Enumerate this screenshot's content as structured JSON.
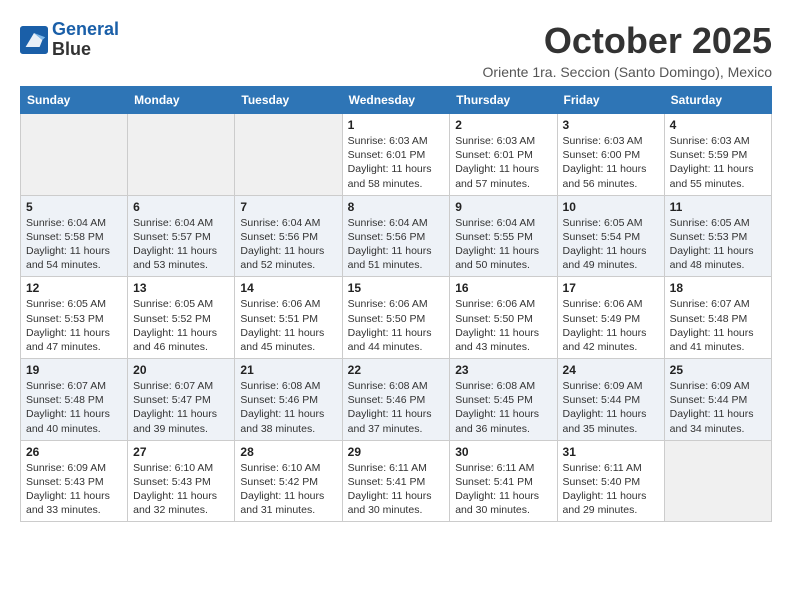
{
  "header": {
    "logo_line1": "General",
    "logo_line2": "Blue",
    "month_title": "October 2025",
    "subtitle": "Oriente 1ra. Seccion (Santo Domingo), Mexico"
  },
  "weekdays": [
    "Sunday",
    "Monday",
    "Tuesday",
    "Wednesday",
    "Thursday",
    "Friday",
    "Saturday"
  ],
  "weeks": [
    [
      {
        "day": "",
        "info": ""
      },
      {
        "day": "",
        "info": ""
      },
      {
        "day": "",
        "info": ""
      },
      {
        "day": "1",
        "info": "Sunrise: 6:03 AM\nSunset: 6:01 PM\nDaylight: 11 hours and 58 minutes."
      },
      {
        "day": "2",
        "info": "Sunrise: 6:03 AM\nSunset: 6:01 PM\nDaylight: 11 hours and 57 minutes."
      },
      {
        "day": "3",
        "info": "Sunrise: 6:03 AM\nSunset: 6:00 PM\nDaylight: 11 hours and 56 minutes."
      },
      {
        "day": "4",
        "info": "Sunrise: 6:03 AM\nSunset: 5:59 PM\nDaylight: 11 hours and 55 minutes."
      }
    ],
    [
      {
        "day": "5",
        "info": "Sunrise: 6:04 AM\nSunset: 5:58 PM\nDaylight: 11 hours and 54 minutes."
      },
      {
        "day": "6",
        "info": "Sunrise: 6:04 AM\nSunset: 5:57 PM\nDaylight: 11 hours and 53 minutes."
      },
      {
        "day": "7",
        "info": "Sunrise: 6:04 AM\nSunset: 5:56 PM\nDaylight: 11 hours and 52 minutes."
      },
      {
        "day": "8",
        "info": "Sunrise: 6:04 AM\nSunset: 5:56 PM\nDaylight: 11 hours and 51 minutes."
      },
      {
        "day": "9",
        "info": "Sunrise: 6:04 AM\nSunset: 5:55 PM\nDaylight: 11 hours and 50 minutes."
      },
      {
        "day": "10",
        "info": "Sunrise: 6:05 AM\nSunset: 5:54 PM\nDaylight: 11 hours and 49 minutes."
      },
      {
        "day": "11",
        "info": "Sunrise: 6:05 AM\nSunset: 5:53 PM\nDaylight: 11 hours and 48 minutes."
      }
    ],
    [
      {
        "day": "12",
        "info": "Sunrise: 6:05 AM\nSunset: 5:53 PM\nDaylight: 11 hours and 47 minutes."
      },
      {
        "day": "13",
        "info": "Sunrise: 6:05 AM\nSunset: 5:52 PM\nDaylight: 11 hours and 46 minutes."
      },
      {
        "day": "14",
        "info": "Sunrise: 6:06 AM\nSunset: 5:51 PM\nDaylight: 11 hours and 45 minutes."
      },
      {
        "day": "15",
        "info": "Sunrise: 6:06 AM\nSunset: 5:50 PM\nDaylight: 11 hours and 44 minutes."
      },
      {
        "day": "16",
        "info": "Sunrise: 6:06 AM\nSunset: 5:50 PM\nDaylight: 11 hours and 43 minutes."
      },
      {
        "day": "17",
        "info": "Sunrise: 6:06 AM\nSunset: 5:49 PM\nDaylight: 11 hours and 42 minutes."
      },
      {
        "day": "18",
        "info": "Sunrise: 6:07 AM\nSunset: 5:48 PM\nDaylight: 11 hours and 41 minutes."
      }
    ],
    [
      {
        "day": "19",
        "info": "Sunrise: 6:07 AM\nSunset: 5:48 PM\nDaylight: 11 hours and 40 minutes."
      },
      {
        "day": "20",
        "info": "Sunrise: 6:07 AM\nSunset: 5:47 PM\nDaylight: 11 hours and 39 minutes."
      },
      {
        "day": "21",
        "info": "Sunrise: 6:08 AM\nSunset: 5:46 PM\nDaylight: 11 hours and 38 minutes."
      },
      {
        "day": "22",
        "info": "Sunrise: 6:08 AM\nSunset: 5:46 PM\nDaylight: 11 hours and 37 minutes."
      },
      {
        "day": "23",
        "info": "Sunrise: 6:08 AM\nSunset: 5:45 PM\nDaylight: 11 hours and 36 minutes."
      },
      {
        "day": "24",
        "info": "Sunrise: 6:09 AM\nSunset: 5:44 PM\nDaylight: 11 hours and 35 minutes."
      },
      {
        "day": "25",
        "info": "Sunrise: 6:09 AM\nSunset: 5:44 PM\nDaylight: 11 hours and 34 minutes."
      }
    ],
    [
      {
        "day": "26",
        "info": "Sunrise: 6:09 AM\nSunset: 5:43 PM\nDaylight: 11 hours and 33 minutes."
      },
      {
        "day": "27",
        "info": "Sunrise: 6:10 AM\nSunset: 5:43 PM\nDaylight: 11 hours and 32 minutes."
      },
      {
        "day": "28",
        "info": "Sunrise: 6:10 AM\nSunset: 5:42 PM\nDaylight: 11 hours and 31 minutes."
      },
      {
        "day": "29",
        "info": "Sunrise: 6:11 AM\nSunset: 5:41 PM\nDaylight: 11 hours and 30 minutes."
      },
      {
        "day": "30",
        "info": "Sunrise: 6:11 AM\nSunset: 5:41 PM\nDaylight: 11 hours and 30 minutes."
      },
      {
        "day": "31",
        "info": "Sunrise: 6:11 AM\nSunset: 5:40 PM\nDaylight: 11 hours and 29 minutes."
      },
      {
        "day": "",
        "info": ""
      }
    ]
  ]
}
